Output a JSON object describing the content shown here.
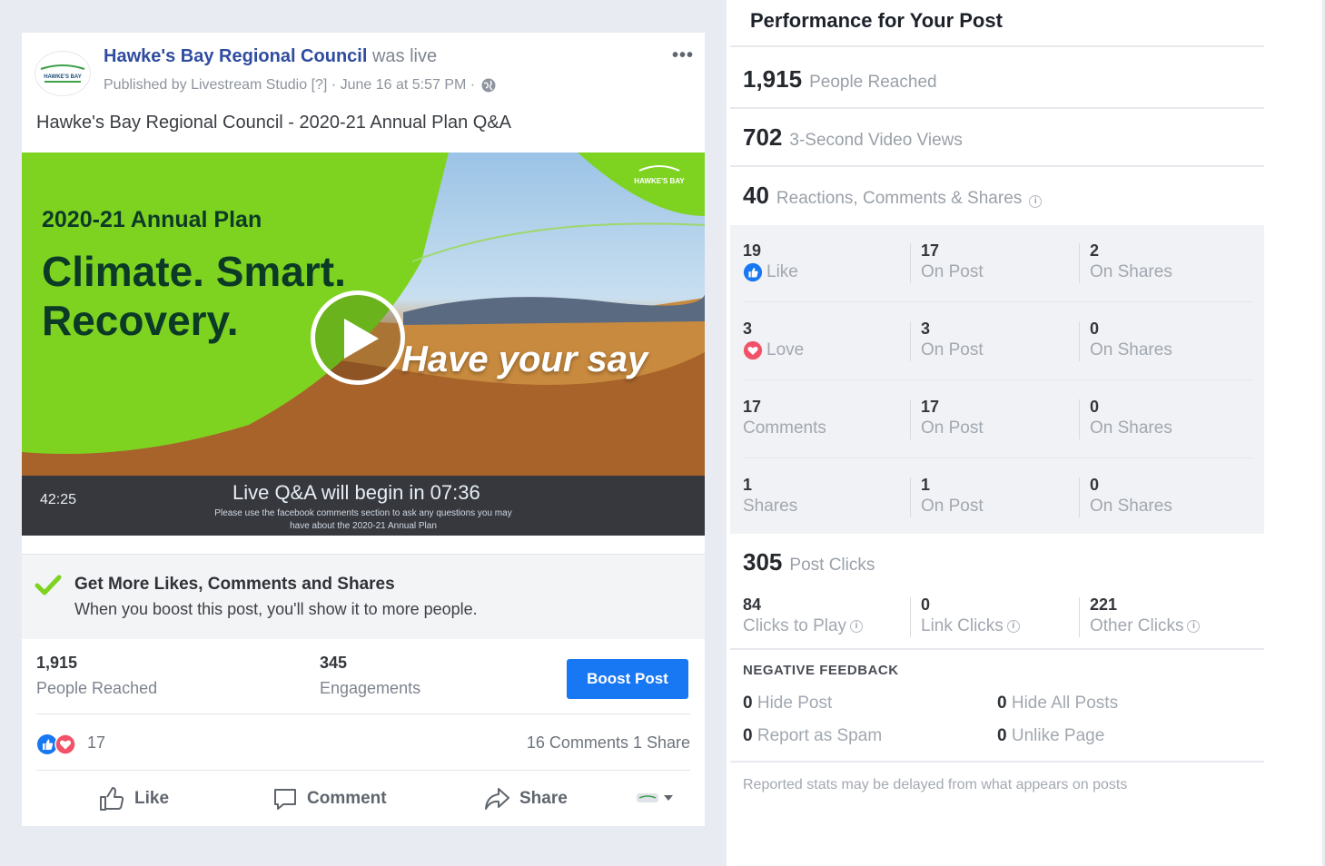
{
  "post": {
    "page_name": "Hawke's Bay Regional Council",
    "was_live": " was live",
    "published_by": "Published by Livestream Studio [?] · June 16 at 5:57 PM ·",
    "more": "•••",
    "text": "Hawke's Bay Regional Council - 2020-21 Annual Plan Q&A",
    "logo_text": "HAWKE'S BAY"
  },
  "video": {
    "plan": "2020-21 Annual Plan",
    "headline_1": "Climate. Smart.",
    "headline_2": "Recovery.",
    "subtitle": "Have your say",
    "duration": "42:25",
    "live_notice": "Live Q&A will begin in 07:36",
    "note_1": "Please use the facebook comments section to ask any questions you may",
    "note_2": "have about the 2020-21 Annual Plan",
    "corner_logo_text": "HAWKE'S BAY"
  },
  "promo": {
    "title": "Get More Likes, Comments and Shares",
    "body": "When you boost this post, you'll show it to more people."
  },
  "stats": {
    "reached_value": "1,915",
    "reached_label": "People Reached",
    "engagements_value": "345",
    "engagements_label": "Engagements",
    "boost_label": "Boost Post"
  },
  "reactions": {
    "count": "17",
    "comments_shares": "16 Comments  1 Share"
  },
  "actions": {
    "like": "Like",
    "comment": "Comment",
    "share": "Share"
  },
  "panel": {
    "title": "Performance for Your Post",
    "people_reached_value": "1,915",
    "people_reached_label": "People Reached",
    "video_views_value": "702",
    "video_views_label": "3-Second Video Views",
    "reactions_value": "40",
    "reactions_label": "Reactions, Comments & Shares",
    "breakdown": [
      {
        "total": "19",
        "label": "Like",
        "on_post": "17",
        "on_post_label": "On Post",
        "on_shares": "2",
        "on_shares_label": "On Shares"
      },
      {
        "total": "3",
        "label": "Love",
        "on_post": "3",
        "on_post_label": "On Post",
        "on_shares": "0",
        "on_shares_label": "On Shares"
      },
      {
        "total": "17",
        "label": "Comments",
        "on_post": "17",
        "on_post_label": "On Post",
        "on_shares": "0",
        "on_shares_label": "On Shares"
      },
      {
        "total": "1",
        "label": "Shares",
        "on_post": "1",
        "on_post_label": "On Post",
        "on_shares": "0",
        "on_shares_label": "On Shares"
      }
    ],
    "post_clicks_value": "305",
    "post_clicks_label": "Post Clicks",
    "clicks": [
      {
        "value": "84",
        "label": "Clicks to Play"
      },
      {
        "value": "0",
        "label": "Link Clicks"
      },
      {
        "value": "221",
        "label": "Other Clicks"
      }
    ],
    "negative_title": "NEGATIVE FEEDBACK",
    "negative": [
      {
        "value": "0",
        "label": "Hide Post"
      },
      {
        "value": "0",
        "label": "Hide All Posts"
      },
      {
        "value": "0",
        "label": "Report as Spam"
      },
      {
        "value": "0",
        "label": "Unlike Page"
      }
    ],
    "footnote": "Reported stats may be delayed from what appears on posts"
  },
  "colors": {
    "accent": "#1877f2",
    "page_name": "#2f4ca0",
    "green": "#7ed321",
    "love": "#f25268"
  }
}
